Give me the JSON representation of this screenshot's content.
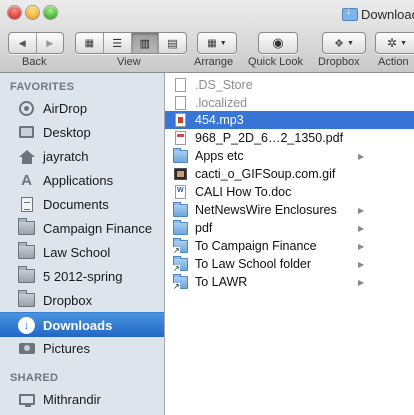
{
  "window": {
    "title": "Downloads"
  },
  "toolbar": {
    "back_label": "Back",
    "view_label": "View",
    "arrange_label": "Arrange",
    "quicklook_label": "Quick Look",
    "dropbox_label": "Dropbox",
    "action_label": "Action"
  },
  "sidebar": {
    "favorites_header": "FAVORITES",
    "shared_header": "SHARED",
    "items": [
      {
        "label": "AirDrop",
        "icon": "airdrop-icon"
      },
      {
        "label": "Desktop",
        "icon": "desktop-icon"
      },
      {
        "label": "jayratch",
        "icon": "home-icon"
      },
      {
        "label": "Applications",
        "icon": "applications-icon"
      },
      {
        "label": "Documents",
        "icon": "documents-icon"
      },
      {
        "label": "Campaign Finance",
        "icon": "folder-icon"
      },
      {
        "label": "Law School",
        "icon": "folder-icon"
      },
      {
        "label": "5 2012-spring",
        "icon": "folder-icon"
      },
      {
        "label": "Dropbox",
        "icon": "folder-icon"
      },
      {
        "label": "Downloads",
        "icon": "downloads-icon",
        "selected": true
      },
      {
        "label": "Pictures",
        "icon": "camera-icon"
      }
    ],
    "shared_items": [
      {
        "label": "Mithrandir",
        "icon": "computer-icon"
      }
    ]
  },
  "files": [
    {
      "name": ".DS_Store",
      "kind": "hidden"
    },
    {
      "name": ".localized",
      "kind": "hidden"
    },
    {
      "name": "454.mp3",
      "kind": "audio",
      "selected": true
    },
    {
      "name": "968_P_2D_6…2_1350.pdf",
      "kind": "pdf"
    },
    {
      "name": "Apps etc",
      "kind": "folder",
      "expandable": true
    },
    {
      "name": "cacti_o_GIFSoup.com.gif",
      "kind": "gif"
    },
    {
      "name": "CALI How To.doc",
      "kind": "word"
    },
    {
      "name": "NetNewsWire Enclosures",
      "kind": "folder",
      "expandable": true
    },
    {
      "name": "pdf",
      "kind": "folder",
      "expandable": true
    },
    {
      "name": "To Campaign Finance",
      "kind": "alias",
      "expandable": true
    },
    {
      "name": "To Law School folder",
      "kind": "alias",
      "expandable": true
    },
    {
      "name": "To LAWR",
      "kind": "alias",
      "expandable": true
    }
  ],
  "colors": {
    "sidebar_bg": "#dde4ec",
    "selection_sidebar": "#2068c4",
    "selection_file": "#3875d7"
  }
}
